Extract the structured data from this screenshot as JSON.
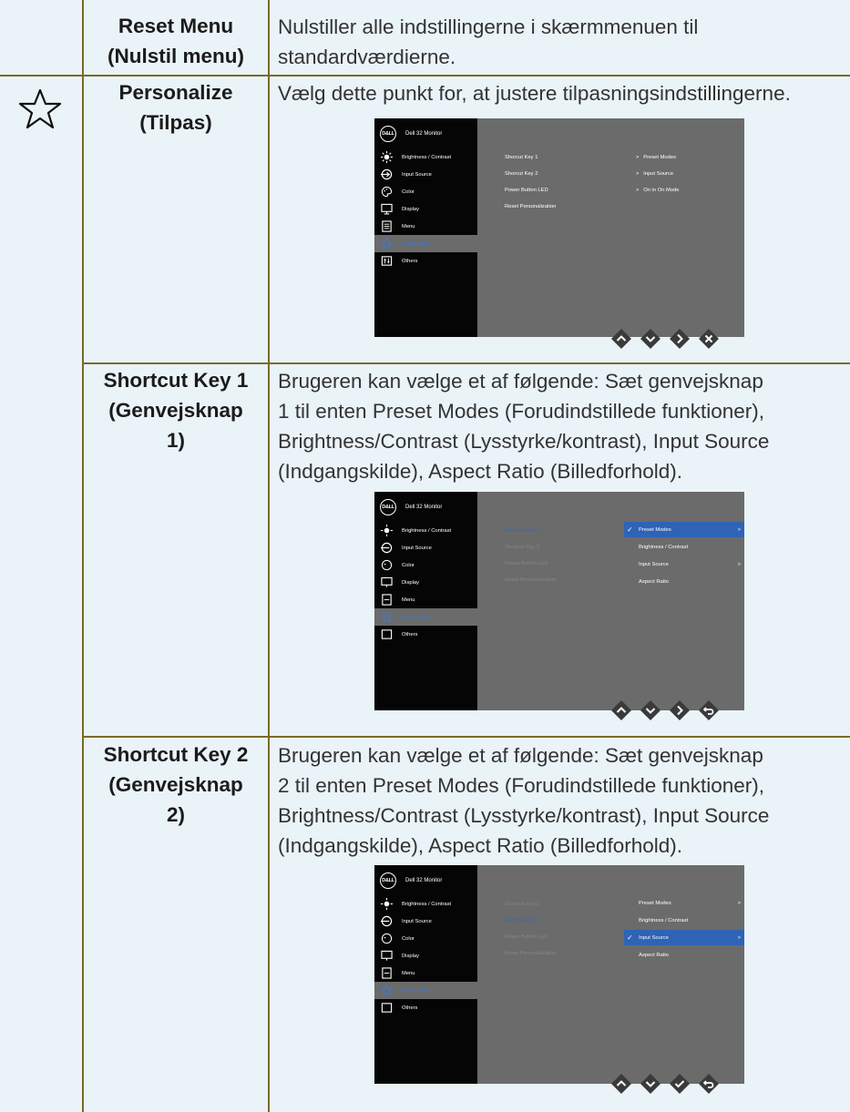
{
  "rows": {
    "reset": {
      "label_1": "Reset Menu",
      "label_2": "(Nulstil menu)",
      "desc_1": "Nulstiller alle indstillingerne i skærmmenuen til",
      "desc_2": "standardværdierne."
    },
    "personalize": {
      "label_1": "Personalize",
      "label_2": "(Tilpas)",
      "desc_1": "Vælg dette punkt for, at justere tilpasningsindstillingerne."
    },
    "shortcut1": {
      "label_1": "Shortcut Key 1",
      "label_2": "(Genvejsknap",
      "label_3": "1)",
      "desc_1": "Brugeren kan vælge et af følgende: Sæt genvejsknap",
      "desc_2": "1 til enten Preset Modes (Forudindstillede funktioner),",
      "desc_3": "Brightness/Contrast (Lysstyrke/kontrast), Input Source",
      "desc_4": "(Indgangskilde), Aspect Ratio (Billedforhold)."
    },
    "shortcut2": {
      "label_1": "Shortcut Key 2",
      "label_2": "(Genvejsknap",
      "label_3": "2)",
      "desc_1": "Brugeren kan vælge et af følgende: Sæt genvejsknap",
      "desc_2": "2 til enten Preset Modes (Forudindstillede funktioner),",
      "desc_3": "Brightness/Contrast (Lysstyrke/kontrast), Input Source",
      "desc_4": "(Indgangskilde), Aspect Ratio (Billedforhold)."
    }
  },
  "osd": {
    "logo": "D&LL",
    "title": "Dell 32 Monitor",
    "menu": [
      "Brightness / Contrast",
      "Input Source",
      "Color",
      "Display",
      "Menu",
      "Personalize",
      "Others"
    ],
    "sub": [
      "Shorcut Key 1",
      "Shorcut Key 2",
      "Power Button LED",
      "Reset Personalization"
    ],
    "sub_shortcut": [
      "Shortcut Key 1",
      "Shortcut Key 2",
      "Power Button LED",
      "Reset Personalization"
    ],
    "values": [
      "Preset Modes",
      "Input Source",
      "On in On Mode"
    ],
    "options": [
      "Preset Modes",
      "Brightness / Contrast",
      "Input Source",
      "Aspect Ratio"
    ],
    "selected_color": "#2f63b6",
    "highlight_color": "#3a7bd5"
  },
  "icons": {
    "row_icon": "star-outline-icon",
    "buttons_1": [
      "up-icon",
      "down-icon",
      "right-icon",
      "close-icon"
    ],
    "buttons_2": [
      "up-icon",
      "down-icon",
      "right-icon",
      "back-icon"
    ],
    "buttons_3": [
      "up-icon",
      "down-icon",
      "check-icon",
      "back-icon"
    ]
  }
}
